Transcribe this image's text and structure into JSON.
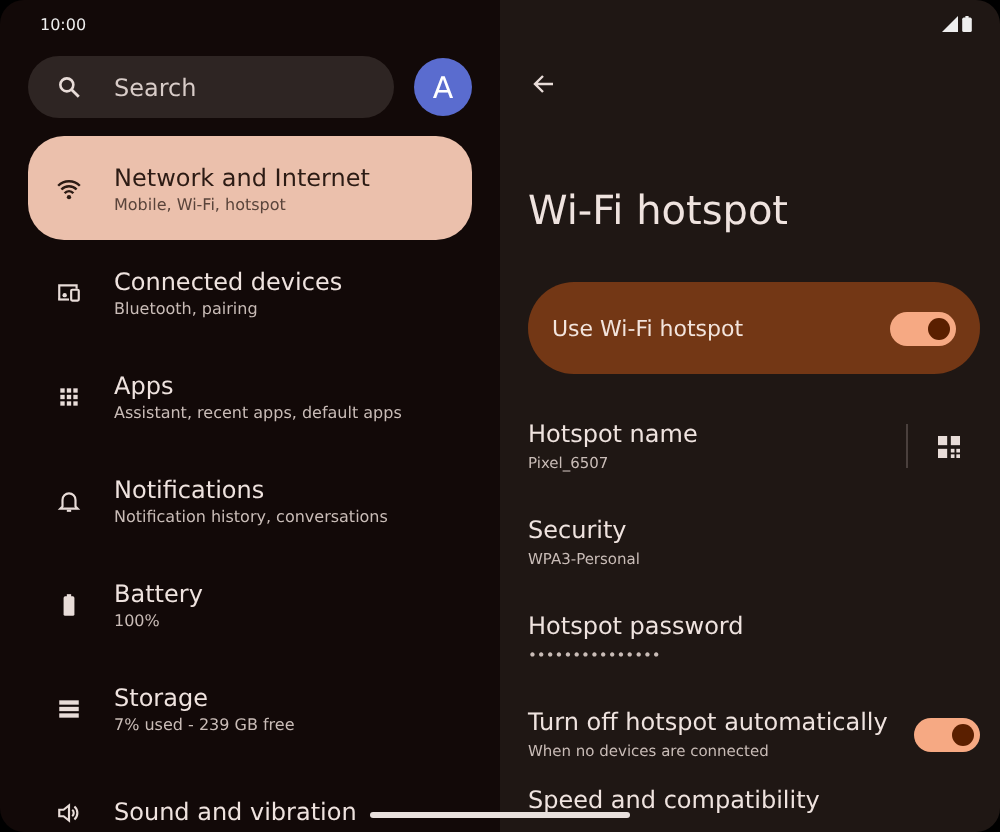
{
  "status_bar": {
    "time": "10:00"
  },
  "search": {
    "placeholder": "Search"
  },
  "account": {
    "initial": "A"
  },
  "sidebar": {
    "items": [
      {
        "kind": "wifi",
        "title": "Network and Internet",
        "subtitle": "Mobile, Wi-Fi, hotspot",
        "selected": true
      },
      {
        "kind": "devices",
        "title": "Connected devices",
        "subtitle": "Bluetooth, pairing",
        "selected": false
      },
      {
        "kind": "apps",
        "title": "Apps",
        "subtitle": "Assistant, recent apps, default apps",
        "selected": false
      },
      {
        "kind": "bell",
        "title": "Notifications",
        "subtitle": "Notification history, conversations",
        "selected": false
      },
      {
        "kind": "battery",
        "title": "Battery",
        "subtitle": "100%",
        "selected": false
      },
      {
        "kind": "storage",
        "title": "Storage",
        "subtitle": "7% used - 239 GB free",
        "selected": false
      },
      {
        "kind": "sound",
        "title": "Sound and vibration",
        "selected": false
      }
    ]
  },
  "detail": {
    "title": "Wi-Fi hotspot",
    "main_switch": {
      "label": "Use Wi-Fi hotspot",
      "on": true
    },
    "rows": [
      {
        "kind": "qr",
        "title": "Hotspot name",
        "subtitle": "Pixel_6507"
      },
      {
        "kind": "plain",
        "title": "Security",
        "subtitle": "WPA3-Personal"
      },
      {
        "kind": "plain",
        "title": "Hotspot password",
        "subtitle": "•••••••••••••••"
      },
      {
        "kind": "switch",
        "title": "Turn off hotspot automatically",
        "subtitle": "When no devices are connected",
        "on": true
      },
      {
        "kind": "plain",
        "title": "Speed and compatibility"
      }
    ]
  }
}
